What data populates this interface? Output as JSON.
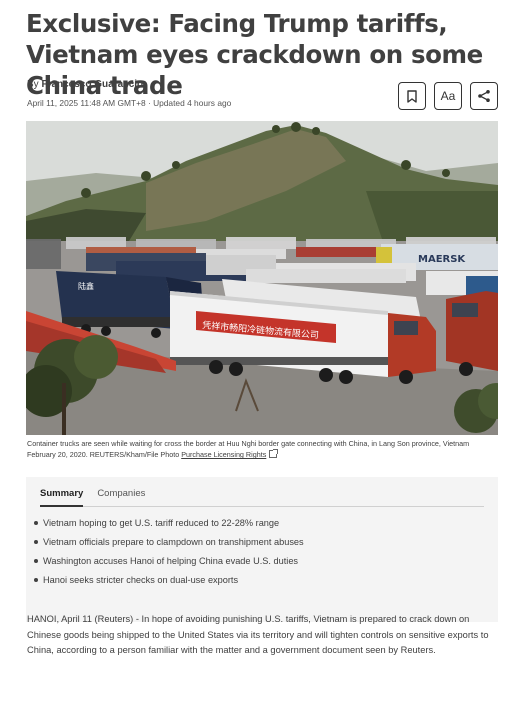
{
  "article": {
    "headline": "Exclusive: Facing Trump tariffs, Vietnam eyes crackdown on some China trade",
    "byline_prefix": "By ",
    "author": "Francesco Guarascio",
    "dateline": "April 11, 2025 11:48 AM GMT+8 · Updated 4 hours ago"
  },
  "tools": {
    "bookmark_icon": "bookmark-icon",
    "text_size_label": "Aa",
    "share_icon": "share-icon"
  },
  "photo": {
    "sign_text": "凭祥市畅阳冷链物流有限公司",
    "maersk_text": "MAERSK",
    "truck_brand": "陆鑫",
    "colors": {
      "sky": "#d9dcd9",
      "ground": "#9a9794",
      "hill": "#5d6a45"
    }
  },
  "caption": {
    "text": "Container trucks are seen while waiting for cross the border at Huu Nghi border gate connecting with China, in Lang Son province, Vietnam February 20, 2020. REUTERS/Kham/File Photo ",
    "license": "Purchase Licensing Rights"
  },
  "summary": {
    "tabs": [
      "Summary",
      "Companies"
    ],
    "bullets": [
      "Vietnam hoping to get U.S. tariff reduced to 22-28% range",
      "Vietnam officials prepare to clampdown on transhipment abuses",
      "Washington accuses Hanoi of helping China evade U.S. duties",
      "Hanoi seeks stricter checks on dual-use exports"
    ]
  },
  "body": {
    "paragraph": "HANOI, April 11 (Reuters) - In hope of avoiding punishing U.S. tariffs, Vietnam is prepared to crack down on Chinese goods being shipped to the United States via its territory and will tighten controls on sensitive exports to China, according to a person familiar with the matter and a government document seen by Reuters."
  }
}
